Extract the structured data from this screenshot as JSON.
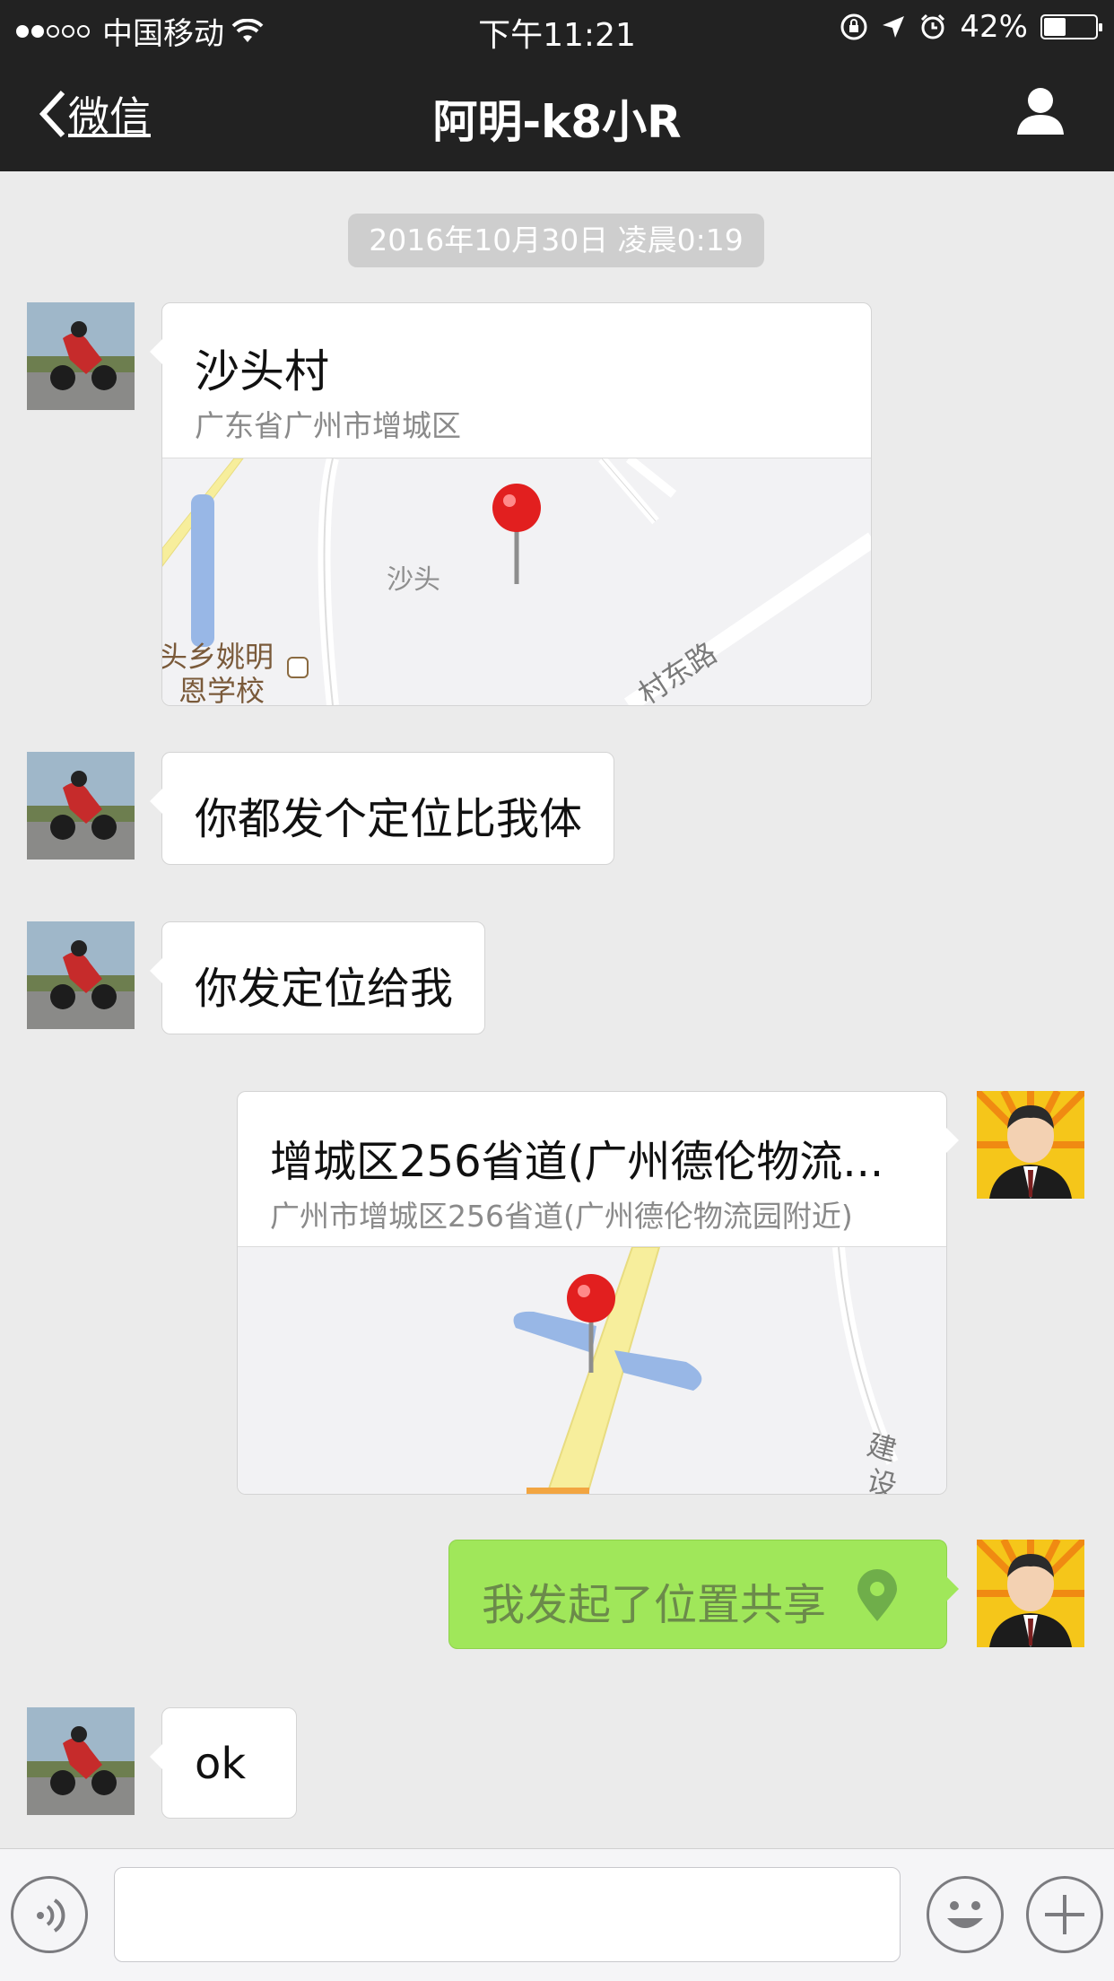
{
  "status_bar": {
    "carrier": "中国移动",
    "time": "下午11:21",
    "battery": "42%",
    "battery_level": 0.42
  },
  "nav": {
    "back_label": "微信",
    "title": "阿明-k8小R"
  },
  "chat": {
    "timestamp": "2016年10月30日 凌晨0:19",
    "messages": [
      {
        "type": "location",
        "title": "沙头村",
        "address": "广东省广州市增城区",
        "map_labels": [
          "沙头",
          "头乡姚明",
          "恩学校",
          "村东路"
        ]
      },
      {
        "type": "text",
        "text": "你都发个定位比我体"
      },
      {
        "type": "text",
        "text": "你发定位给我"
      },
      {
        "type": "location",
        "title": "增城区256省道(广州德伦物流...",
        "address": "广州市增城区256省道(广州德伦物流园附近)",
        "map_labels": [
          "建",
          "设"
        ]
      },
      {
        "type": "share",
        "text": "我发起了位置共享"
      },
      {
        "type": "text",
        "text": "ok"
      }
    ]
  }
}
